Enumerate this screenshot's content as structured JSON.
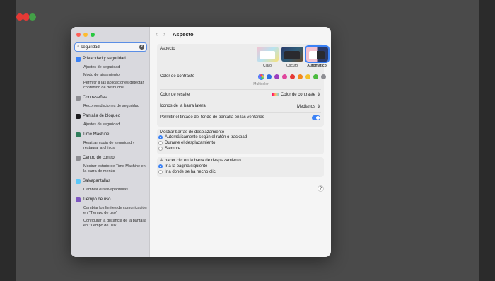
{
  "colors": {
    "accent": "#3b82f6",
    "sidebar_bg": "#d9d9de"
  },
  "search": {
    "value": "seguridad"
  },
  "sidebar": {
    "groups": [
      {
        "label": "Privacidad y seguridad",
        "icon": "hand-icon",
        "color": "#3b82f6",
        "items": [
          "Ajustes de seguridad",
          "Modo de aislamiento",
          "Permitir a las aplicaciones detectar contenido de desnudos"
        ]
      },
      {
        "label": "Contraseñas",
        "icon": "key-icon",
        "color": "#8e8e93",
        "items": [
          "Recomendaciones de seguridad"
        ]
      },
      {
        "label": "Pantalla de bloqueo",
        "icon": "lock-screen-icon",
        "color": "#1c1c1e",
        "items": [
          "Ajustes de seguridad"
        ]
      },
      {
        "label": "Time Machine",
        "icon": "time-machine-icon",
        "color": "#2f7d5b",
        "items": [
          "Realizar copia de seguridad y restaurar archivos"
        ]
      },
      {
        "label": "Centro de control",
        "icon": "control-center-icon",
        "color": "#8e8e93",
        "items": [
          "Mostrar estado de Time Machine en la barra de menús"
        ]
      },
      {
        "label": "Salvapantallas",
        "icon": "screensaver-icon",
        "color": "#5ac8fa",
        "items": [
          "Cambiar el salvapantallas"
        ]
      },
      {
        "label": "Tiempo de uso",
        "icon": "hourglass-icon",
        "color": "#7e57c2",
        "items": [
          "Cambiar los límites de comunicación en \"Tiempo de uso\"",
          "Configurar la distancia de la pantalla en \"Tiempo de uso\""
        ]
      }
    ]
  },
  "header": {
    "back": "‹",
    "forward": "›",
    "title": "Aspecto"
  },
  "appearance": {
    "label": "Aspecto",
    "options": [
      {
        "label": "Claro",
        "selected": false
      },
      {
        "label": "Oscuro",
        "selected": false
      },
      {
        "label": "Automático",
        "selected": true
      }
    ]
  },
  "contrast": {
    "label": "Color de contraste",
    "caption": "Multicolor",
    "swatches": [
      "#ff6b6b",
      "#2f6fe0",
      "#9b3fbf",
      "#e0479d",
      "#e53935",
      "#f28a1e",
      "#f4c12a",
      "#4cbb3f",
      "#8e8e93"
    ]
  },
  "highlight": {
    "label": "Color de resalte",
    "value": "Color de contraste"
  },
  "sidebar_icons": {
    "label": "Iconos de la barra lateral",
    "value": "Medianos"
  },
  "tinting": {
    "label": "Permitir el tintado del fondo de pantalla en las ventanas",
    "on": true
  },
  "scrollbars": {
    "label": "Mostrar barras de desplazamiento",
    "options": [
      "Automáticamente según el ratón o trackpad",
      "Durante el desplazamiento",
      "Siempre"
    ],
    "selected": 0
  },
  "click": {
    "label": "Al hacer clic en la barra de desplazamiento",
    "options": [
      "Ir a la página siguiente",
      "Ir a donde se ha hecho clic"
    ],
    "selected": 0
  },
  "help": "?"
}
